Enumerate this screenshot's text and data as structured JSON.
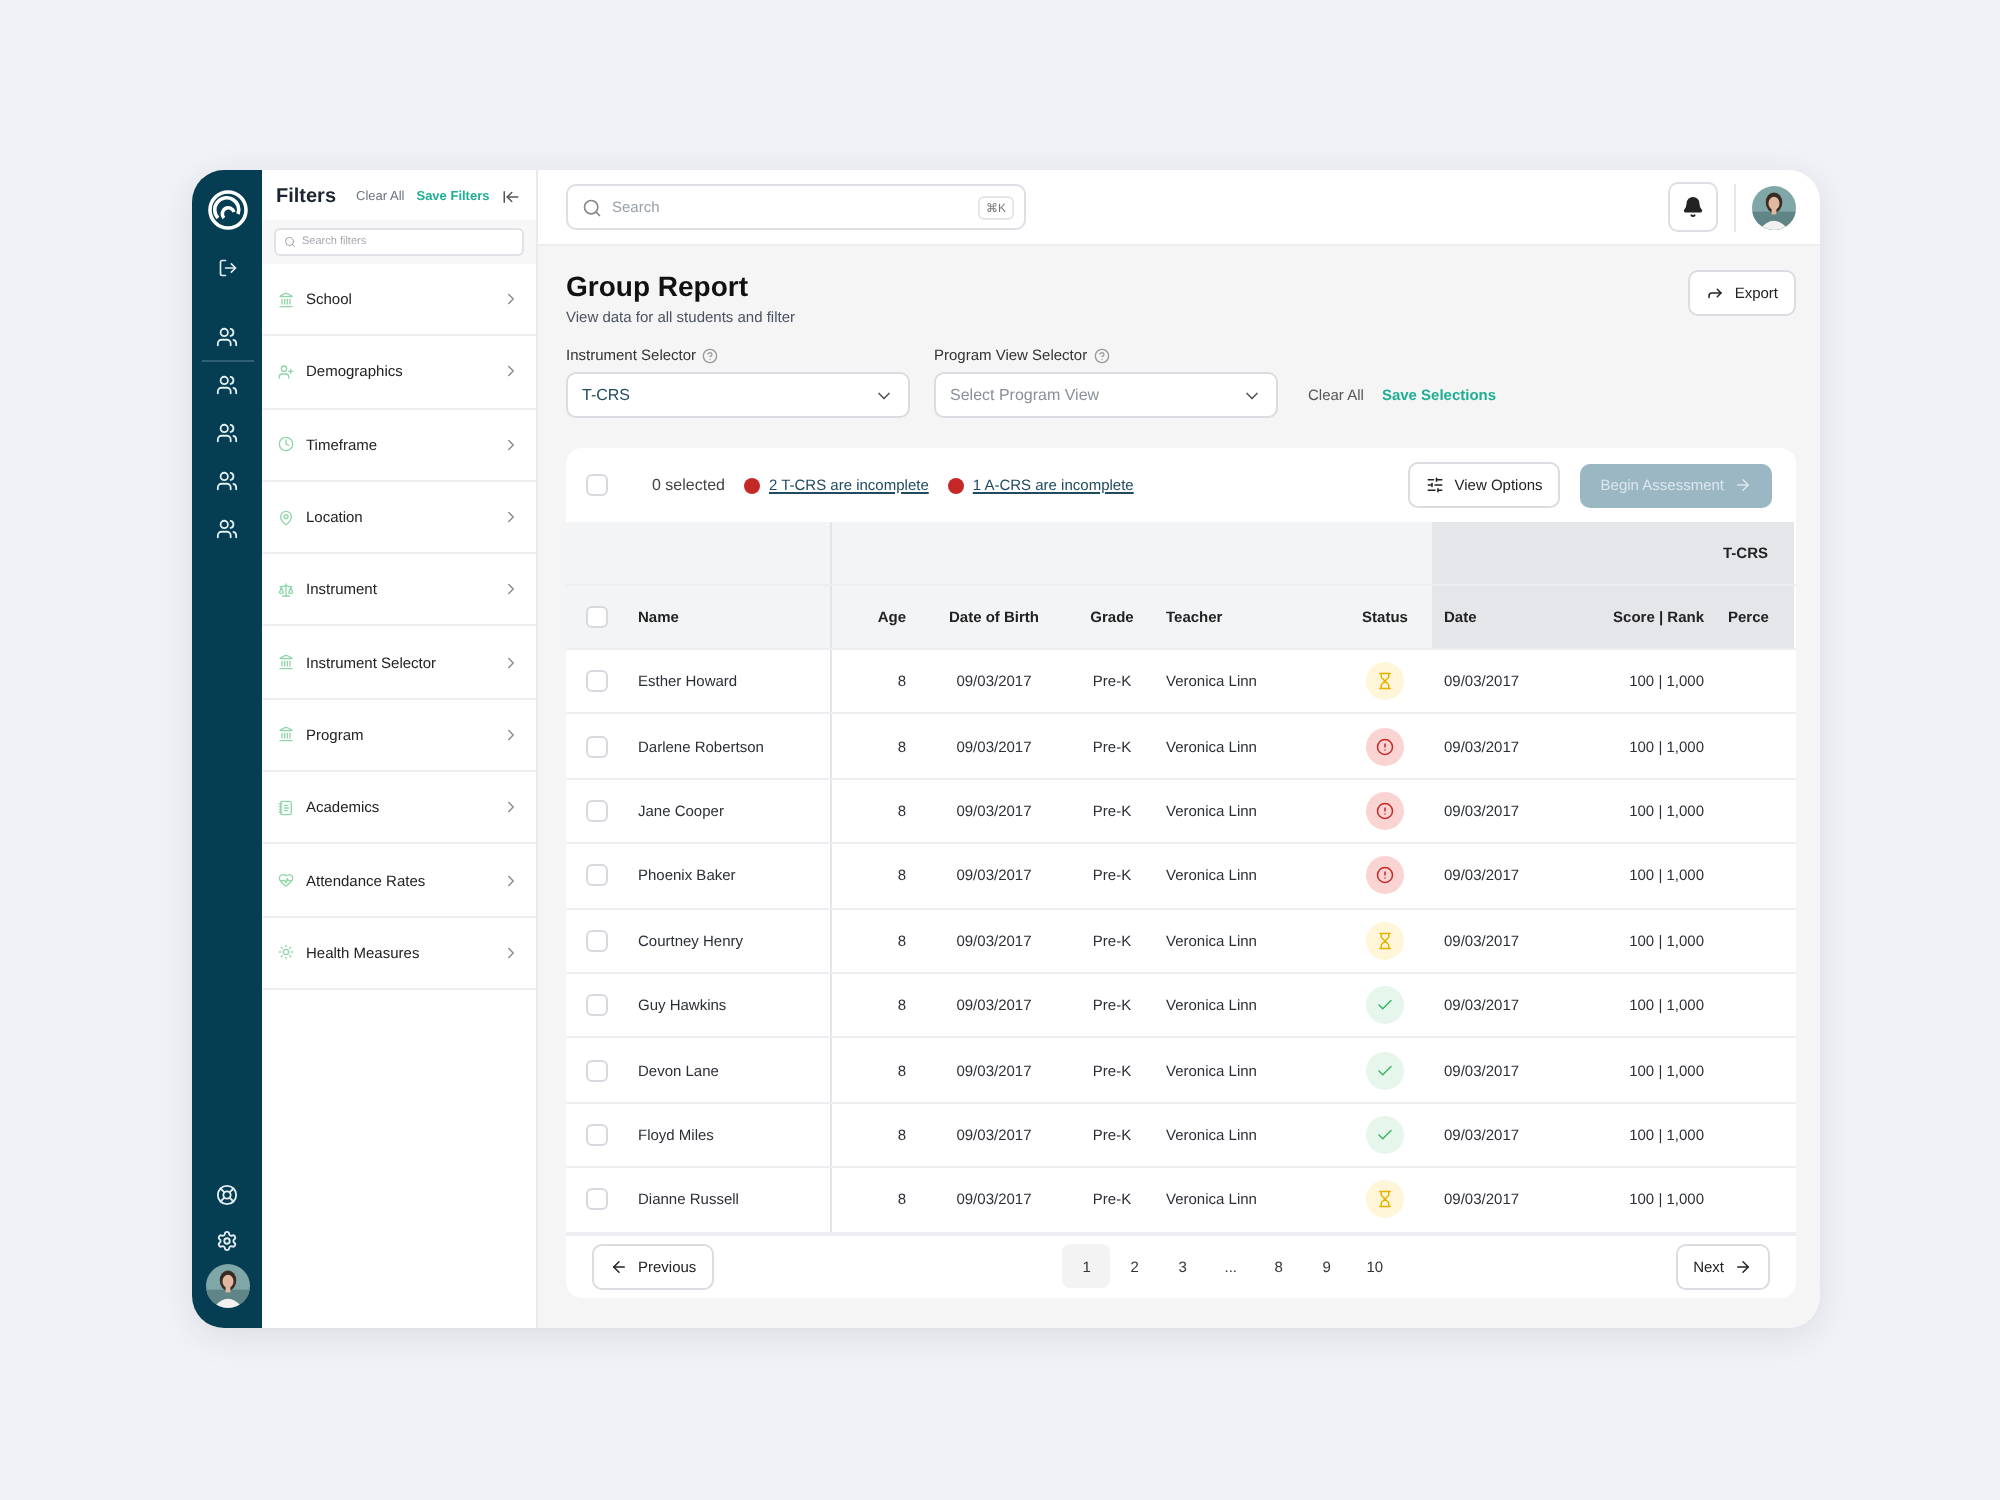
{
  "filters": {
    "title": "Filters",
    "clear_all": "Clear All",
    "save": "Save Filters",
    "search_placeholder": "Search filters",
    "items": [
      {
        "label": "School"
      },
      {
        "label": "Demographics"
      },
      {
        "label": "Timeframe"
      },
      {
        "label": "Location"
      },
      {
        "label": "Instrument"
      },
      {
        "label": "Instrument Selector"
      },
      {
        "label": "Program"
      },
      {
        "label": "Academics"
      },
      {
        "label": "Attendance Rates"
      },
      {
        "label": "Health Measures"
      }
    ]
  },
  "topbar": {
    "search_placeholder": "Search",
    "shortcut": "⌘K"
  },
  "page": {
    "title": "Group Report",
    "subtitle": "View data for all students and filter",
    "export": "Export"
  },
  "selectors": [
    {
      "label": "Instrument Selector",
      "value": "T-CRS"
    },
    {
      "label": "Program View Selector",
      "placeholder": "Select Program View"
    }
  ],
  "selector_actions": {
    "clear_all": "Clear All",
    "save": "Save Selections"
  },
  "toolbar": {
    "select_all_checked": false,
    "selected_count": "0 selected",
    "alerts": [
      "2 T-CRS are incomplete",
      "1 A-CRS are incomplete"
    ],
    "view_options": "View Options",
    "begin": {
      "label": "Begin Assessment",
      "disabled": true
    }
  },
  "table": {
    "group": "T-CRS",
    "header_checked": false,
    "columns": [
      "Name",
      "Age",
      "Date of Birth",
      "Grade",
      "Teacher",
      "Status",
      "Date",
      "Score | Rank",
      "Perce"
    ],
    "rows": [
      {
        "checked": false,
        "kind": "pending",
        "name": "Esther Howard",
        "age": "8",
        "dob": "09/03/2017",
        "grade": "Pre-K",
        "teacher": "Veronica Linn",
        "date": "09/03/2017",
        "score": "100 | 1,000"
      },
      {
        "checked": false,
        "kind": "alert",
        "name": "Darlene Robertson",
        "age": "8",
        "dob": "09/03/2017",
        "grade": "Pre-K",
        "teacher": "Veronica Linn",
        "date": "09/03/2017",
        "score": "100 | 1,000"
      },
      {
        "checked": false,
        "kind": "alert",
        "name": "Jane Cooper",
        "age": "8",
        "dob": "09/03/2017",
        "grade": "Pre-K",
        "teacher": "Veronica Linn",
        "date": "09/03/2017",
        "score": "100 | 1,000"
      },
      {
        "checked": false,
        "kind": "alert",
        "name": "Phoenix Baker",
        "age": "8",
        "dob": "09/03/2017",
        "grade": "Pre-K",
        "teacher": "Veronica Linn",
        "date": "09/03/2017",
        "score": "100 | 1,000"
      },
      {
        "checked": false,
        "kind": "pending",
        "name": "Courtney Henry",
        "age": "8",
        "dob": "09/03/2017",
        "grade": "Pre-K",
        "teacher": "Veronica Linn",
        "date": "09/03/2017",
        "score": "100 | 1,000"
      },
      {
        "checked": false,
        "kind": "done",
        "name": "Guy Hawkins",
        "age": "8",
        "dob": "09/03/2017",
        "grade": "Pre-K",
        "teacher": "Veronica Linn",
        "date": "09/03/2017",
        "score": "100 | 1,000"
      },
      {
        "checked": false,
        "kind": "done",
        "name": "Devon Lane",
        "age": "8",
        "dob": "09/03/2017",
        "grade": "Pre-K",
        "teacher": "Veronica Linn",
        "date": "09/03/2017",
        "score": "100 | 1,000"
      },
      {
        "checked": false,
        "kind": "done",
        "name": "Floyd Miles",
        "age": "8",
        "dob": "09/03/2017",
        "grade": "Pre-K",
        "teacher": "Veronica Linn",
        "date": "09/03/2017",
        "score": "100 | 1,000"
      },
      {
        "checked": false,
        "kind": "pending",
        "name": "Dianne Russell",
        "age": "8",
        "dob": "09/03/2017",
        "grade": "Pre-K",
        "teacher": "Veronica Linn",
        "date": "09/03/2017",
        "score": "100 | 1,000"
      }
    ]
  },
  "pagination": {
    "previous": "Previous",
    "next": "Next",
    "pages": [
      {
        "label": "1",
        "selected": true
      },
      {
        "label": "2",
        "selected": false
      },
      {
        "label": "3",
        "selected": false
      },
      {
        "label": "...",
        "selected": false
      },
      {
        "label": "8",
        "selected": false
      },
      {
        "label": "9",
        "selected": false
      },
      {
        "label": "10",
        "selected": false
      }
    ]
  }
}
